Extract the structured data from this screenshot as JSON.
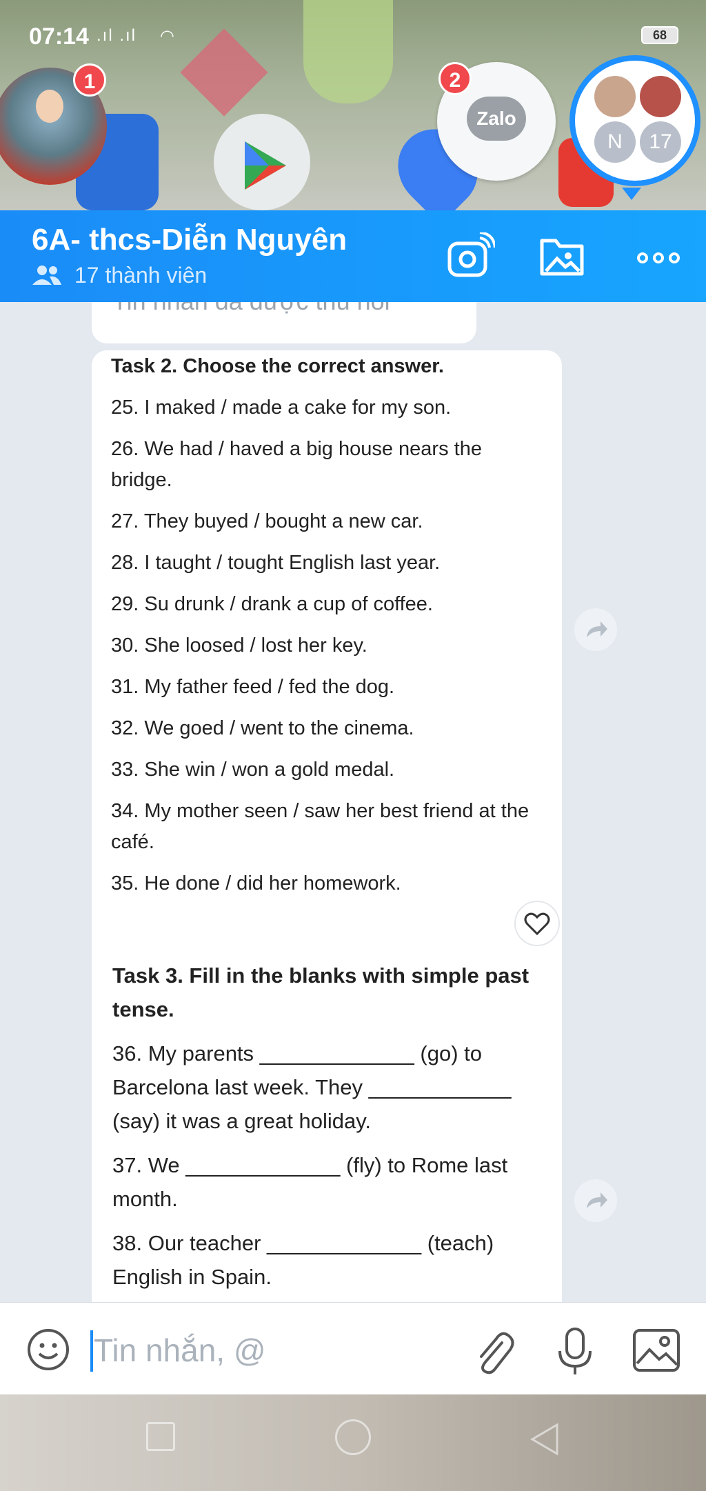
{
  "status_bar": {
    "time": "07:14",
    "signal": ".ıl .ıl",
    "battery": "68"
  },
  "chat_heads": [
    {
      "badge": "1"
    },
    {
      "label": "Zalo",
      "badge": "2"
    },
    {
      "avatars": [
        "N",
        "17"
      ]
    }
  ],
  "header": {
    "title": "6A- thcs-Diễn Nguyên",
    "subtitle": "17 thành viên"
  },
  "messages": {
    "recalled": "Tin nhắn đã được thu hồi",
    "task2": {
      "heading": "Task 2. Choose the correct answer.",
      "lines": [
        "25. I maked / made a cake for my son.",
        "26. We had / haved a big house nears the bridge.",
        "27. They buyed / bought a new car.",
        "28. I taught / tought English last year.",
        "29. Su drunk / drank a cup of coffee.",
        "30. She loosed / lost her key.",
        "31. My father feed / fed the dog.",
        "32. We goed / went to the cinema.",
        "33. She win / won a gold medal.",
        "34. My mother seen / saw her best friend at the café.",
        "35. He done / did her homework."
      ]
    },
    "task3": {
      "heading": "Task 3. Fill in the blanks with simple past tense.",
      "lines": [
        "36. My parents _____________ (go) to Barcelona last week. They ____________ (say) it was a great holiday.",
        "37. We _____________ (fly) to Rome last month.",
        "38. Our teacher _____________ (teach) English in Spain."
      ]
    }
  },
  "input": {
    "placeholder": "Tin nhắn, @"
  },
  "colors": {
    "header_start": "#1a8cf7",
    "header_end": "#17a5ff",
    "chat_bg": "#e4e9f0",
    "badge": "#f0484c"
  }
}
